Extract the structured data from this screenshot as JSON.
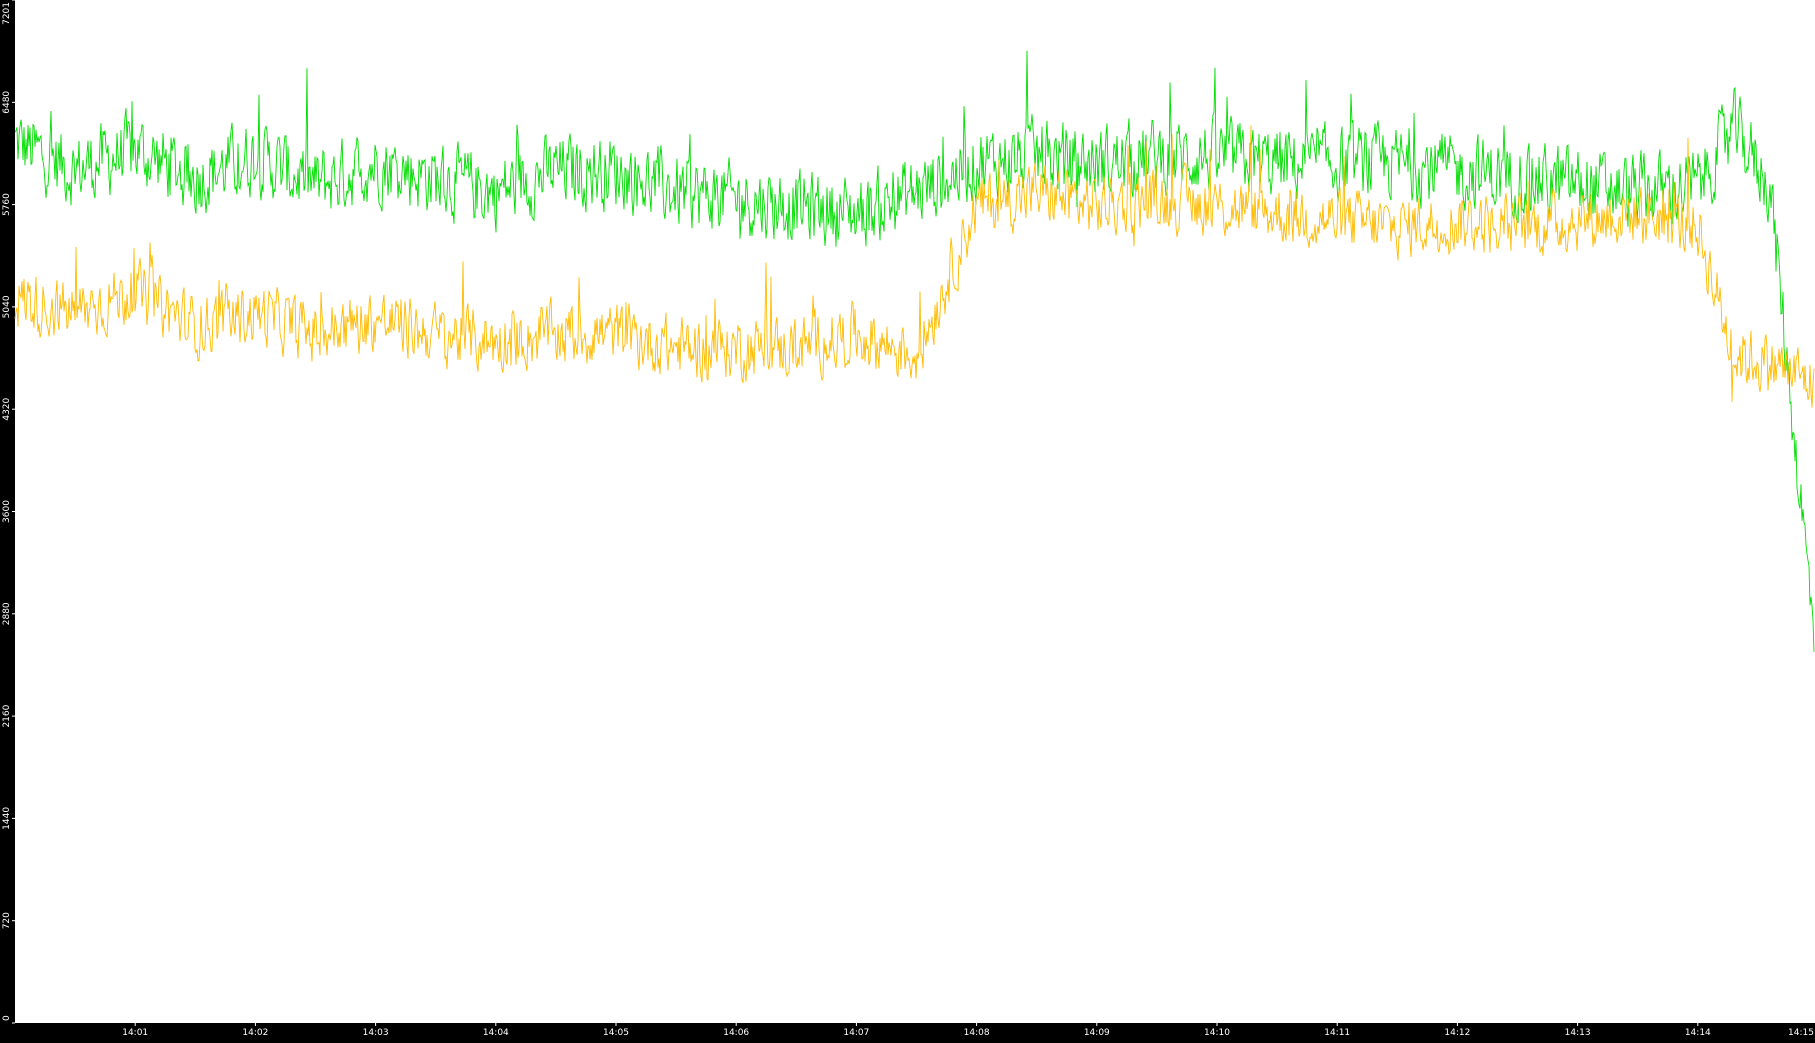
{
  "chart_data": {
    "type": "line",
    "title": "",
    "xlabel": "",
    "ylabel": "",
    "ylim": [
      0,
      7201
    ],
    "y_ticks": [
      "0",
      "720",
      "1440",
      "2160",
      "2880",
      "3600",
      "4320",
      "5040",
      "5760",
      "6480",
      "7201"
    ],
    "x_range_minutes": [
      840,
      854.975
    ],
    "x_ticks": [
      {
        "label": "14:01",
        "minute": 841
      },
      {
        "label": "14:02",
        "minute": 842
      },
      {
        "label": "14:03",
        "minute": 843
      },
      {
        "label": "14:04",
        "minute": 844
      },
      {
        "label": "14:05",
        "minute": 845
      },
      {
        "label": "14:06",
        "minute": 846
      },
      {
        "label": "14:07",
        "minute": 847
      },
      {
        "label": "14:08",
        "minute": 848
      },
      {
        "label": "14:09",
        "minute": 849
      },
      {
        "label": "14:10",
        "minute": 850
      },
      {
        "label": "14:11",
        "minute": 851
      },
      {
        "label": "14:12",
        "minute": 852
      },
      {
        "label": "14:13",
        "minute": 853
      },
      {
        "label": "14:14",
        "minute": 854
      },
      {
        "label": "14:15",
        "minute": 855
      }
    ],
    "grid": false,
    "background": "#ffffff",
    "axis_background": "#000000",
    "series": [
      {
        "color": "#00dd00",
        "x": [
          "14:00",
          "14:00.5",
          "14:01",
          "14:01.5",
          "14:02",
          "14:02.5",
          "14:03",
          "14:03.5",
          "14:04",
          "14:04.5",
          "14:05",
          "14:05.5",
          "14:06",
          "14:06.5",
          "14:07",
          "14:07.5",
          "14:08",
          "14:08.5",
          "14:09",
          "14:09.5",
          "14:10",
          "14:10.5",
          "14:11",
          "14:11.5",
          "14:12",
          "14:12.5",
          "14:13",
          "14:13.5",
          "14:14",
          "14:14.3",
          "14:14.6",
          "14:14.97"
        ],
        "values": [
          6200,
          6000,
          6150,
          5950,
          6100,
          5900,
          6050,
          5950,
          5850,
          6000,
          6000,
          5850,
          5800,
          5750,
          5700,
          5850,
          6050,
          6100,
          6050,
          6100,
          6100,
          6050,
          6050,
          6050,
          6000,
          5950,
          5900,
          5850,
          5900,
          6300,
          5900,
          2700
        ],
        "noise": 500
      },
      {
        "color": "#ffbb00",
        "x": [
          "14:00",
          "14:00.5",
          "14:01",
          "14:01.5",
          "14:02",
          "14:02.5",
          "14:03",
          "14:03.5",
          "14:04",
          "14:04.5",
          "14:05",
          "14:05.5",
          "14:06",
          "14:06.5",
          "14:07",
          "14:07.5",
          "14:08",
          "14:08.5",
          "14:09",
          "14:09.5",
          "14:10",
          "14:10.5",
          "14:11",
          "14:11.5",
          "14:12",
          "14:12.5",
          "14:13",
          "14:13.5",
          "14:14",
          "14:14.3",
          "14:14.6",
          "14:14.97"
        ],
        "values": [
          5100,
          5000,
          5150,
          4900,
          5000,
          4850,
          4950,
          4850,
          4800,
          4850,
          4850,
          4750,
          4750,
          4750,
          4850,
          4700,
          5750,
          5850,
          5750,
          5800,
          5750,
          5700,
          5650,
          5600,
          5650,
          5600,
          5650,
          5700,
          5600,
          4700,
          4650,
          4500
        ],
        "noise": 420
      }
    ]
  }
}
